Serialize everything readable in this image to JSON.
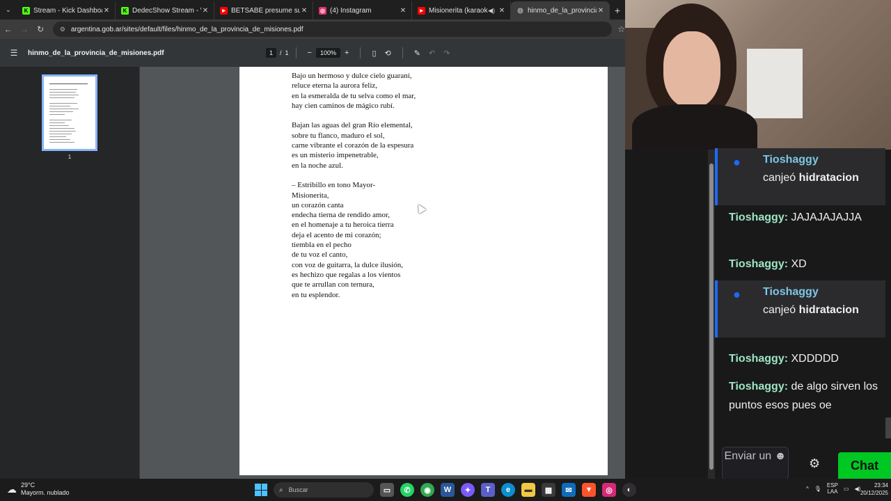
{
  "browser": {
    "tabs": [
      {
        "title": "Stream - Kick Dashboard",
        "icon": "kick-icon",
        "color": "#53fc18",
        "glyph": "K"
      },
      {
        "title": "DedecShow Stream - Watc",
        "icon": "kick-icon",
        "color": "#53fc18",
        "glyph": "K"
      },
      {
        "title": "BETSABÉ presume sus BOT",
        "icon": "youtube-icon",
        "color": "#ff0000",
        "glyph": "▶"
      },
      {
        "title": "(4) Instagram",
        "icon": "instagram-icon",
        "color": "#e1306c",
        "glyph": "◎"
      },
      {
        "title": "Misionerita (karaoke)",
        "icon": "youtube-icon",
        "color": "#ff0000",
        "glyph": "▶"
      },
      {
        "title": "hinmo_de_la_provincia_de",
        "icon": "globe-icon",
        "color": "#9aa0a6",
        "glyph": "◍"
      }
    ],
    "url": "argentina.gob.ar/sites/default/files/hinmo_de_la_provincia_de_misiones.pdf"
  },
  "pdf": {
    "filename": "hinmo_de_la_provincia_de_misiones.pdf",
    "page_current": "1",
    "page_sep": "/",
    "page_total": "1",
    "zoom": "100%",
    "thumb_label": "1",
    "stanzas": [
      [
        "Bajo un hermoso y dulce cielo guaraní,",
        "reluce eterna la aurora feliz,",
        "en la esmeralda de tu selva como el mar,",
        "hay cien caminos de mágico rubí."
      ],
      [
        "Bajan las aguas del gran Río elemental,",
        "sobre tu flanco, maduro el sol,",
        "carne vibrante el corazón de la espesura",
        "es un misterio impenetrable,",
        "en la noche azul."
      ],
      [
        "– Estribillo en tono Mayor-",
        "Misionerita,",
        "un corazón canta",
        "endecha tierna de rendido amor,",
        "en el homenaje a tu heroica tierra",
        "deja el acento de mi corazón;",
        "tiembla en el pecho",
        "de tu voz el canto,",
        "con voz de guitarra, la dulce ilusión,",
        "es hechizo que regalas a los vientos",
        "que te arrullan con ternura,",
        "en tu esplendor."
      ]
    ]
  },
  "chat": {
    "redeem1": {
      "user": "Tioshaggy",
      "text": "canjeó",
      "reward": "hidratacion"
    },
    "msg1": {
      "user": "Tioshaggy:",
      "text": "JAJAJAJAJJA"
    },
    "msg2": {
      "user": "Tioshaggy:",
      "text": "XD"
    },
    "redeem2": {
      "user": "Tioshaggy",
      "text": "canjeó",
      "reward": "hidratacion"
    },
    "msg3": {
      "user": "Tioshaggy:",
      "text": "XDDDDD"
    },
    "msg4": {
      "user": "Tioshaggy:",
      "text": "de algo sirven los puntos esos pues oe"
    },
    "send_label": "Enviar un",
    "chat_button": "Chat"
  },
  "taskbar": {
    "temp": "29°C",
    "weather": "Mayorm. nublado",
    "search_placeholder": "Buscar",
    "lang1": "ESP",
    "lang2": "LAA",
    "time": "23:34",
    "date": "20/12/2025"
  }
}
